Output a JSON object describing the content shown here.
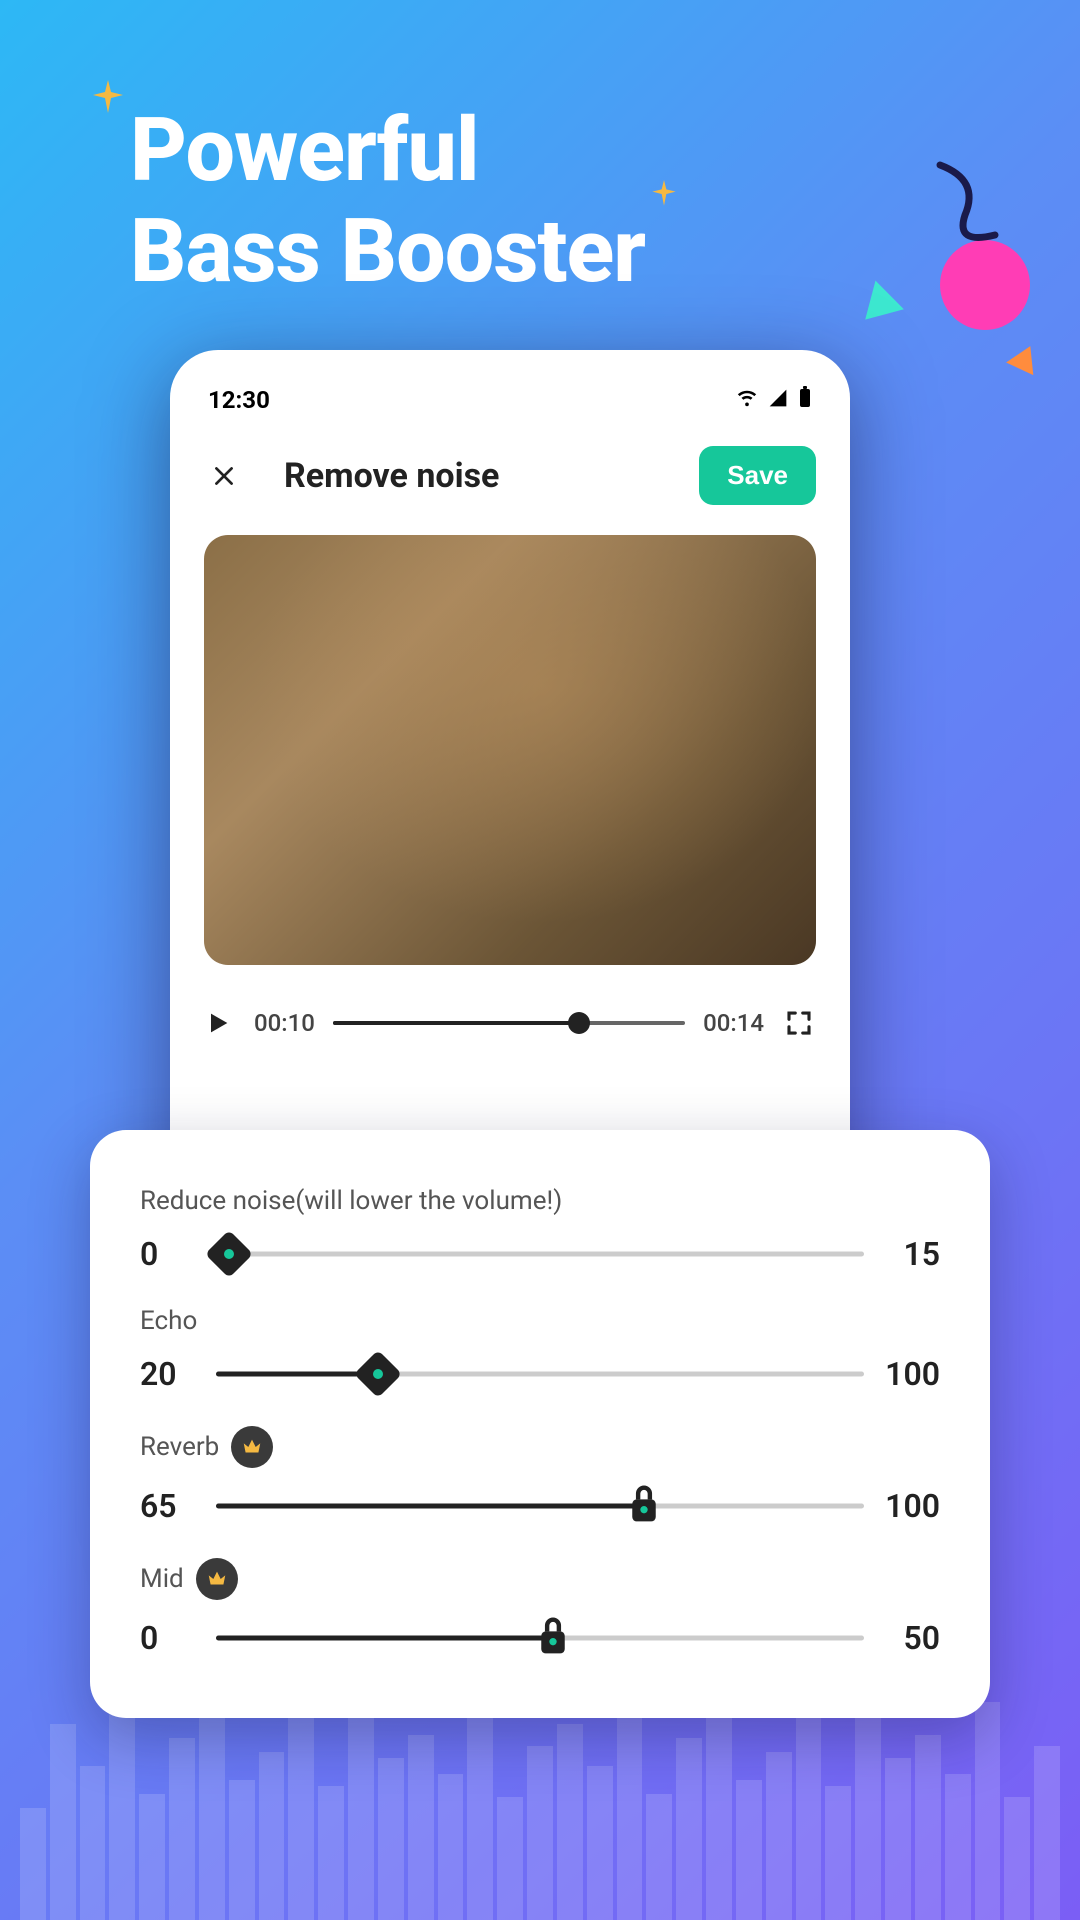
{
  "headline_line1": "Powerful",
  "headline_line2": "Bass Booster",
  "statusbar": {
    "time": "12:30"
  },
  "topbar": {
    "title": "Remove noise",
    "save_label": "Save"
  },
  "player": {
    "current_time": "00:10",
    "total_time": "00:14",
    "progress_pct": 70
  },
  "controls": [
    {
      "label": "Reduce noise(will lower the volume!)",
      "min": 0,
      "max": 15,
      "value": 0,
      "premium": false,
      "locked": false
    },
    {
      "label": "Echo",
      "min": 20,
      "max": 100,
      "value": 40,
      "premium": false,
      "locked": false
    },
    {
      "label": "Reverb",
      "min": 65,
      "max": 100,
      "value": 90,
      "premium": true,
      "locked": true
    },
    {
      "label": "Mid",
      "min": 0,
      "max": 50,
      "value": 25,
      "premium": true,
      "locked": true
    }
  ],
  "colors": {
    "accent_teal": "#16c79a"
  }
}
